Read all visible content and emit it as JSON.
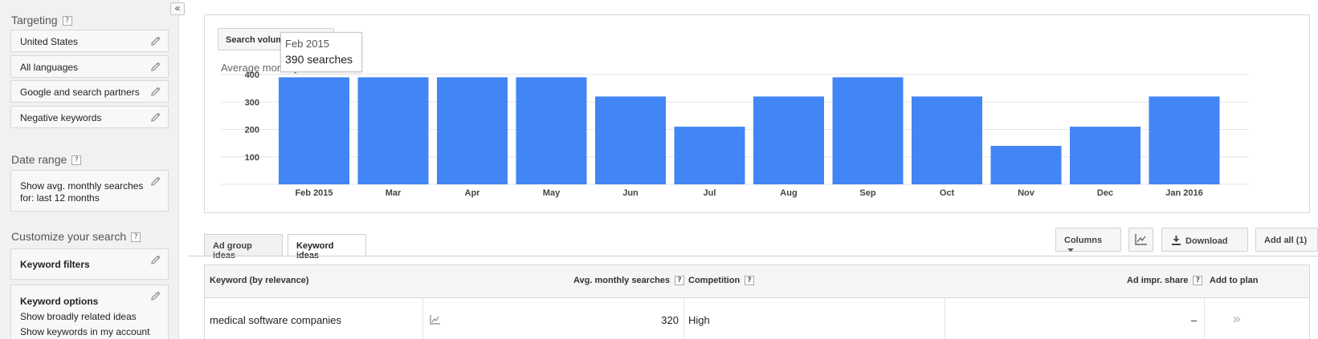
{
  "sidebar": {
    "collapse_label": "«",
    "targeting": {
      "title": "Targeting",
      "items": [
        "United States",
        "All languages",
        "Google and search partners",
        "Negative keywords"
      ]
    },
    "date_range": {
      "title": "Date range",
      "line1": "Show avg. monthly searches",
      "line2": "for: last 12 months"
    },
    "customize": {
      "title": "Customize your search",
      "keyword_filters": "Keyword filters",
      "keyword_options": "Keyword options",
      "option1": "Show broadly related ideas",
      "option2": "Show keywords in my account"
    },
    "help_glyph": "?"
  },
  "chart_panel": {
    "dropdown_label": "Search volume trends",
    "subtitle": "Average monthly searches",
    "tooltip": {
      "month": "Feb 2015",
      "value": "390 searches"
    }
  },
  "chart_data": {
    "type": "bar",
    "categories": [
      "Feb 2015",
      "Mar",
      "Apr",
      "May",
      "Jun",
      "Jul",
      "Aug",
      "Sep",
      "Oct",
      "Nov",
      "Dec",
      "Jan 2016"
    ],
    "values": [
      390,
      390,
      390,
      390,
      320,
      210,
      320,
      390,
      320,
      140,
      210,
      320
    ],
    "yticks": [
      100,
      200,
      300,
      400
    ],
    "ylim": [
      0,
      400
    ],
    "color": "#4285f4",
    "grid": true
  },
  "tabs": [
    "Ad group ideas",
    "Keyword ideas"
  ],
  "toolbar": {
    "columns_label": "Columns",
    "download_label": "Download",
    "add_all_label": "Add all (1)"
  },
  "table": {
    "headers": {
      "keyword": "Keyword (by relevance)",
      "avg": "Avg. monthly searches",
      "competition": "Competition",
      "impr": "Ad impr. share",
      "add": "Add to plan"
    },
    "rows": [
      {
        "keyword": "medical software companies",
        "avg": "320",
        "competition": "High",
        "impr": "–",
        "add": "»"
      }
    ]
  }
}
